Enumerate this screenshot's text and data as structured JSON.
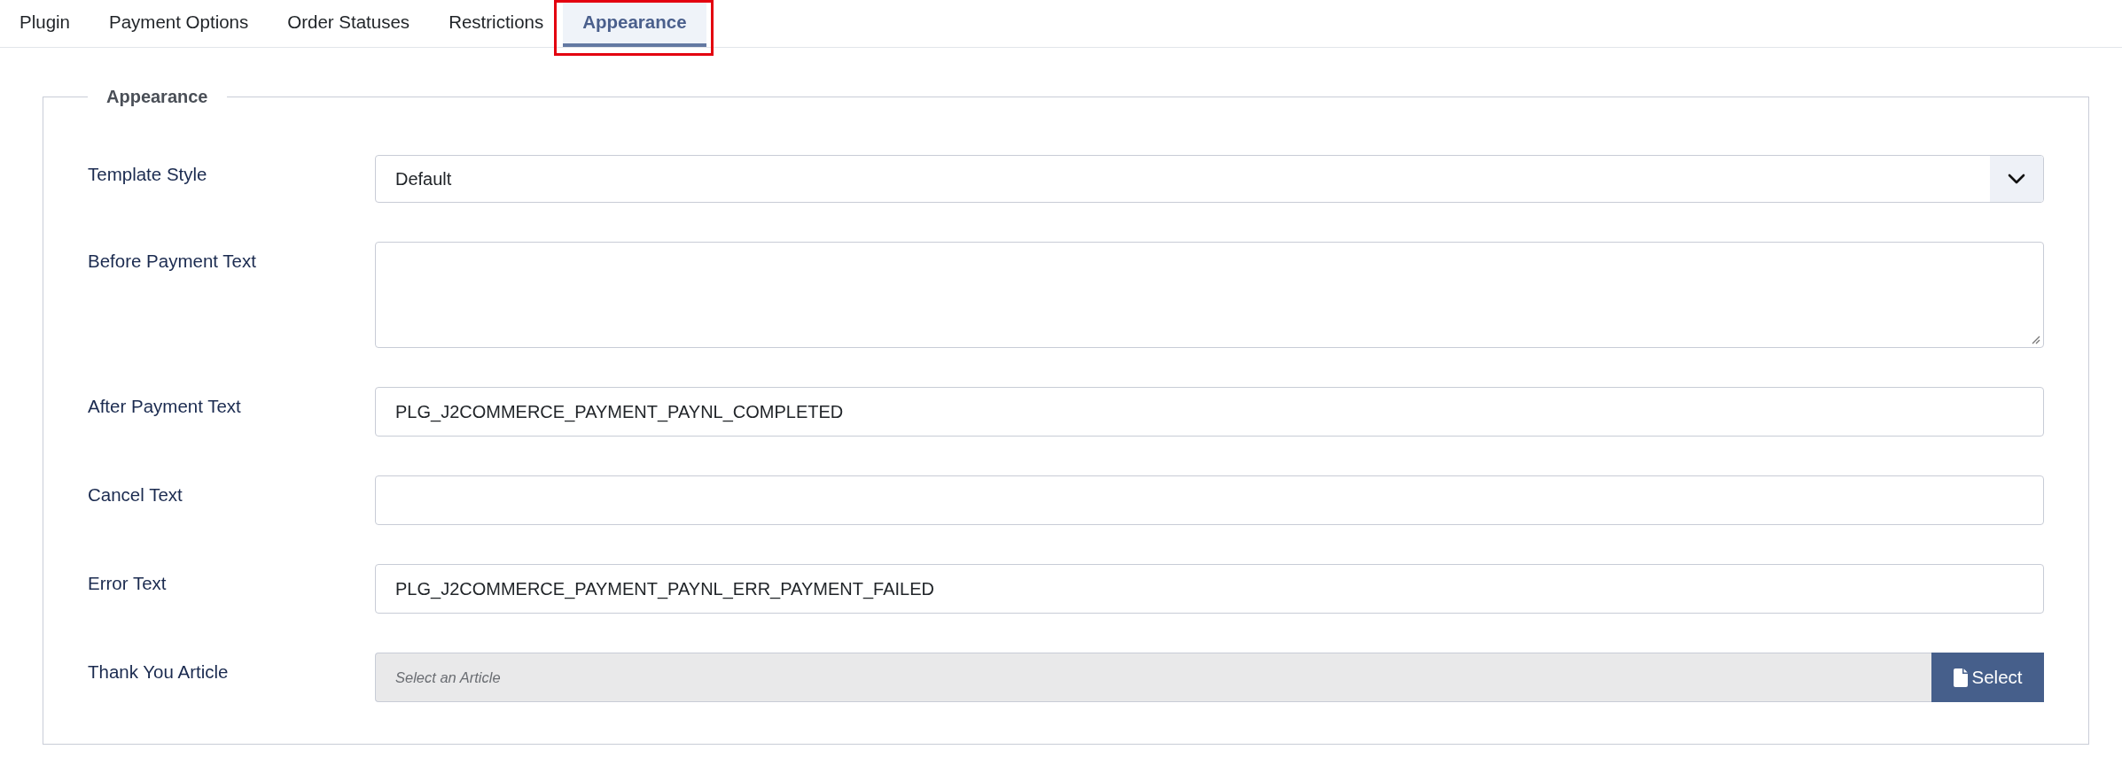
{
  "tabs": [
    {
      "label": "Plugin",
      "selected": false,
      "highlighted": false
    },
    {
      "label": "Payment Options",
      "selected": false,
      "highlighted": false
    },
    {
      "label": "Order Statuses",
      "selected": false,
      "highlighted": false
    },
    {
      "label": "Restrictions",
      "selected": false,
      "highlighted": false
    },
    {
      "label": "Appearance",
      "selected": true,
      "highlighted": true
    }
  ],
  "panel": {
    "legend": "Appearance",
    "fields": [
      {
        "kind": "select",
        "label": "Template Style",
        "value": "Default"
      },
      {
        "kind": "textarea",
        "label": "Before Payment Text"
      },
      {
        "kind": "text",
        "label": "After Payment Text",
        "value": "PLG_J2COMMERCE_PAYMENT_PAYNL_COMPLETED"
      },
      {
        "kind": "text",
        "label": "Cancel Text"
      },
      {
        "kind": "text",
        "label": "Error Text",
        "value": "PLG_J2COMMERCE_PAYMENT_PAYNL_ERR_PAYMENT_FAILED"
      },
      {
        "kind": "article",
        "label": "Thank You Article",
        "placeholder": "Select an Article",
        "button": "Select"
      }
    ]
  }
}
